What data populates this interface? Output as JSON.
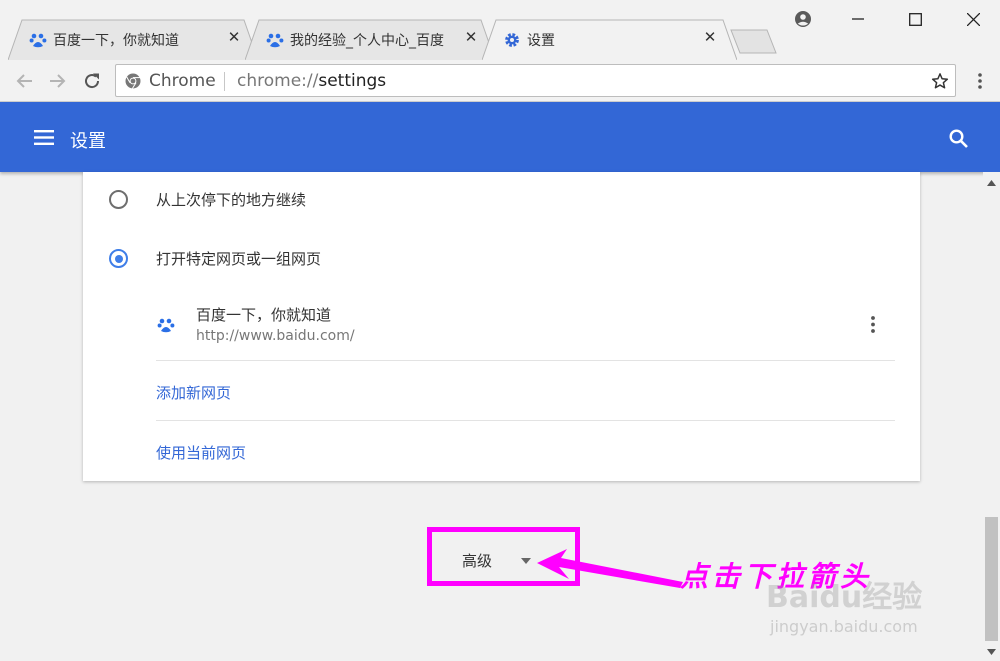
{
  "tabs": [
    {
      "title": "百度一下，你就知道",
      "icon": "baidu-paw-icon",
      "active": false
    },
    {
      "title": "我的经验_个人中心_百度",
      "icon": "baidu-paw-icon",
      "active": false
    },
    {
      "title": "设置",
      "icon": "gear-icon",
      "active": true
    }
  ],
  "omnibox": {
    "label": "Chrome",
    "url_prefix": "chrome://",
    "url_host": "settings"
  },
  "header": {
    "title": "设置"
  },
  "startup": {
    "option_continue": "从上次停下的地方继续",
    "option_specific": "打开特定网页或一组网页",
    "selected": "option_specific",
    "page": {
      "title": "百度一下，你就知道",
      "url": "http://www.baidu.com/"
    },
    "add_page_link": "添加新网页",
    "use_current_link": "使用当前网页"
  },
  "advanced_label": "高级",
  "annotation": {
    "text": "点击下拉箭头",
    "color": "#ff00ff"
  },
  "watermark": {
    "text": "Baidu经验",
    "url": "jingyan.baidu.com"
  },
  "colors": {
    "brand_blue": "#3367d6",
    "baidu_blue": "#2b6fe6",
    "annotation": "#ff00ff"
  }
}
